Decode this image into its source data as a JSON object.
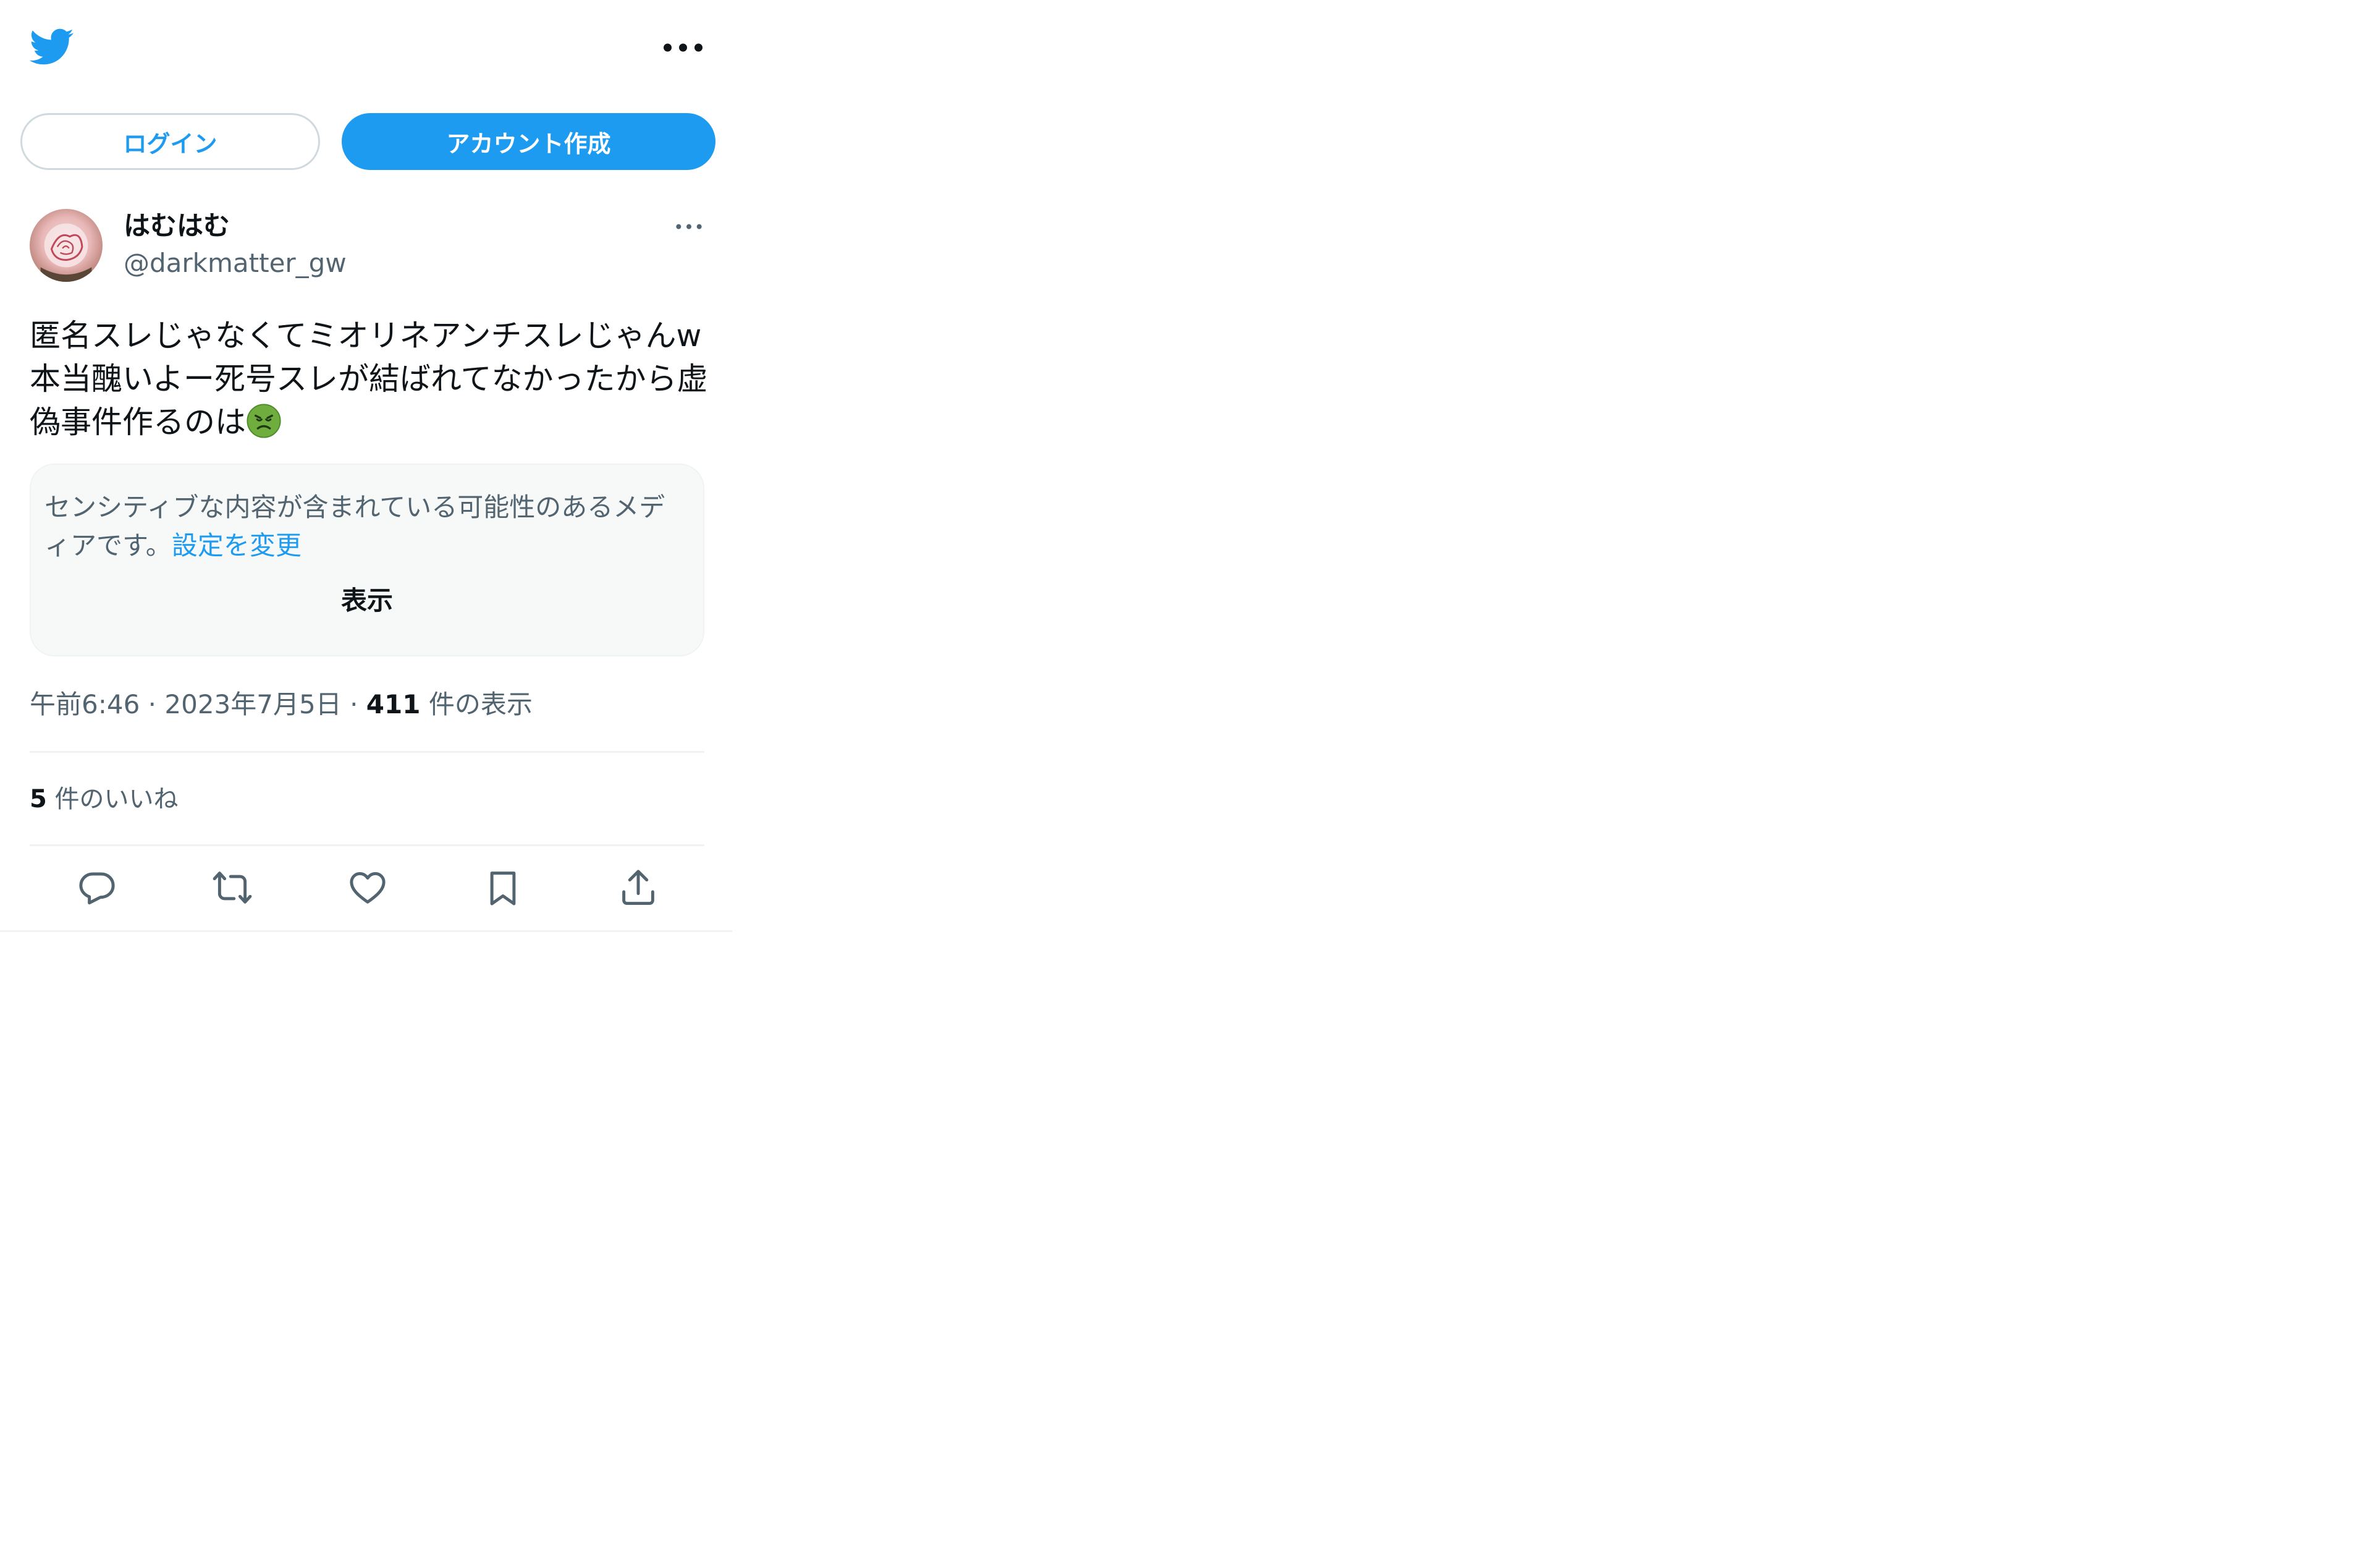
{
  "header": {
    "logo_icon": "twitter-bird-icon",
    "more_icon": "more-horizontal-icon"
  },
  "auth": {
    "login_label": "ログイン",
    "signup_label": "アカウント作成"
  },
  "tweet": {
    "author": {
      "display_name": "はむはむ",
      "handle": "@darkmatter_gw"
    },
    "text_lines": [
      "匿名スレじゃなくてミオリネアンチスレじゃんw",
      "本当醜いよー死号スレが結ばれてなかったから虚",
      "偽事件作るのは"
    ],
    "emoji": "nauseated-face-icon",
    "sensitive": {
      "line1": "センシティブな内容が含まれている可能性のあるメデ",
      "line2_prefix": "ィアです。",
      "settings_link": "設定を変更",
      "show_label": "表示"
    },
    "meta": {
      "time": "午前6:46",
      "sep1": " · ",
      "date": "2023年7月5日",
      "sep2": " · ",
      "views_count": "411",
      "views_label": " 件の表示"
    },
    "likes": {
      "count": "5",
      "label": " 件のいいね"
    },
    "actions": [
      {
        "name": "reply-icon"
      },
      {
        "name": "retweet-icon"
      },
      {
        "name": "like-icon"
      },
      {
        "name": "bookmark-icon"
      },
      {
        "name": "share-icon"
      }
    ]
  },
  "colors": {
    "accent": "#1d9bf0",
    "text": "#0f1419",
    "secondary": "#536471",
    "border": "#cfd9de",
    "divider": "#eff3f4",
    "box_bg": "#f7f9f9"
  }
}
